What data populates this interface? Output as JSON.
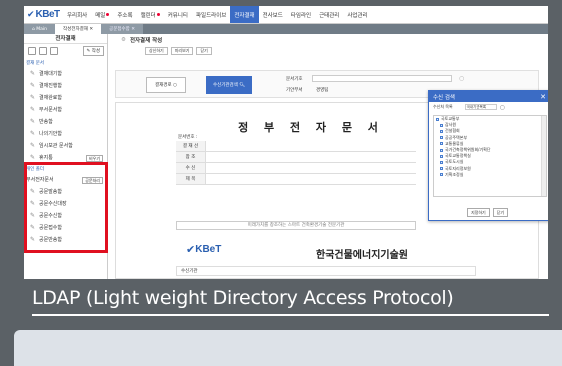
{
  "topnav": {
    "logo": "KBeT",
    "menu": [
      "우리회사",
      "메일",
      "주소록",
      "캘린더",
      "커뮤니티",
      "파일드라이브",
      "전자결재",
      "전사보드",
      "타임라인",
      "근태관리",
      "사업관리"
    ],
    "active_index": 6
  },
  "tabs": {
    "main": "Main",
    "current": "작성전자결재",
    "other": "공문접수함"
  },
  "sidebar": {
    "title": "전자결재",
    "write_label": "작성",
    "section1": "결재 문서",
    "items": [
      {
        "label": "결재대기함"
      },
      {
        "label": "결재진행함"
      },
      {
        "label": "결재완료함"
      },
      {
        "label": "부서문서함"
      },
      {
        "label": "반송함"
      },
      {
        "label": "나의기안함"
      },
      {
        "label": "임시보관 문서함"
      },
      {
        "label": "휴지통",
        "count": "비우기"
      }
    ],
    "section2": "개인 폴더",
    "folder_label": "부서전자문서",
    "folder_btn": "공문처리",
    "folder_items": [
      {
        "label": "공문발송함"
      },
      {
        "label": "공문수신대장"
      },
      {
        "label": "공문수신함"
      },
      {
        "label": "공문접수함"
      },
      {
        "label": "공문반송함"
      }
    ]
  },
  "content": {
    "title": "전자결재 작성",
    "buttons": [
      "상신하기",
      "미리보기",
      "닫기"
    ],
    "approval_line_btn": "결재경로",
    "recipient_btn": "수신기관검색",
    "doc_no_label": "문서기호",
    "dept_label": "기안부서",
    "dept_value": "경영팀",
    "doc_title": "정 부 전 자 문 서",
    "doc_no_field": "문서번호 :",
    "rows": [
      "결 재 선",
      "참 조",
      "수 신",
      "제 목"
    ],
    "slogan": "미래가치를 창조하는 스마트 건축환경기술 전문기관",
    "org_logo": "KBeT",
    "org_name": "한국건물에너지기술원",
    "recv_label": "수신기관"
  },
  "popup": {
    "title": "수신 검색",
    "search_label": "수신처 목록",
    "search_select": "국내기관목록",
    "tree": [
      "국토교통부",
      "감사원",
      "건설협회",
      "공공주택본부",
      "교통물류실",
      "국가건축정책위원회/기획단",
      "국토교통정책실",
      "국토도시실",
      "국토지리정보원",
      "기획조정실"
    ],
    "buttons": [
      "지정하기",
      "닫기"
    ]
  },
  "caption": "LDAP (Light weight Directory Access Protocol)"
}
